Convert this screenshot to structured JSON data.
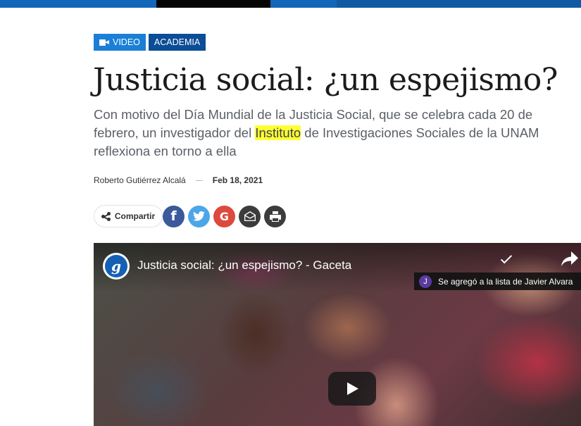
{
  "colors": {
    "topbar": "#1466b8",
    "tag_video": "#1a7fd6",
    "tag_academia": "#0b4d96",
    "highlight": "#ffff33",
    "facebook": "#3b5a9a",
    "twitter": "#4ba7e8",
    "google": "#dc4a3d",
    "dark_icon": "#3c3c3c"
  },
  "tags": {
    "video": "VIDEO",
    "academia": "ACADEMIA"
  },
  "article": {
    "title": "Justicia social: ¿un espejismo?",
    "subtitle_before": "Con motivo del Día Mundial de la Justicia Social, que se celebra cada 20 de febrero, un investigador del ",
    "subtitle_highlight": "Instituto",
    "subtitle_after": " de Investigaciones Sociales de la UNAM reflexiona en torno a ella",
    "author": "Roberto Gutiérrez Alcalá",
    "date": "Feb 18, 2021"
  },
  "share": {
    "label": "Compartir",
    "icon": "share-icon",
    "networks": [
      {
        "name": "facebook",
        "glyph": "f"
      },
      {
        "name": "twitter",
        "glyph": "🐦"
      },
      {
        "name": "google",
        "glyph": "G"
      },
      {
        "name": "email",
        "glyph": ""
      },
      {
        "name": "print",
        "glyph": ""
      }
    ]
  },
  "video": {
    "channel_logo": "g",
    "title": "Justicia social: ¿un espejismo? - Gaceta",
    "toast_avatar": "J",
    "toast_text": "Se agregó a la lista de Javier Alvara",
    "icons": [
      "check-icon",
      "share-arrow-icon",
      "play-icon"
    ]
  }
}
